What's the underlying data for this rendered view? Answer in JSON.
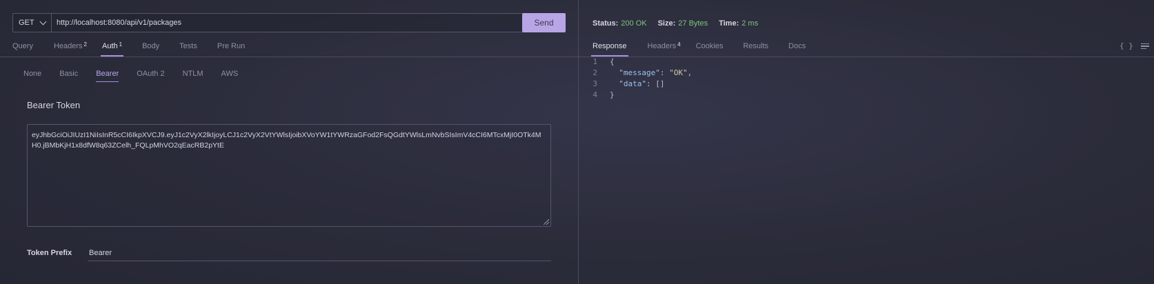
{
  "request": {
    "method": "GET",
    "url": "http://localhost:8080/api/v1/packages",
    "send_label": "Send"
  },
  "request_tabs": [
    {
      "label": "Query",
      "badge": ""
    },
    {
      "label": "Headers",
      "badge": "2"
    },
    {
      "label": "Auth",
      "badge": "1"
    },
    {
      "label": "Body",
      "badge": ""
    },
    {
      "label": "Tests",
      "badge": ""
    },
    {
      "label": "Pre Run",
      "badge": ""
    }
  ],
  "auth_tabs": [
    "None",
    "Basic",
    "Bearer",
    "OAuth 2",
    "NTLM",
    "AWS"
  ],
  "auth": {
    "section_title": "Bearer Token",
    "token": "eyJhbGciOiJIUzI1NiIsInR5cCI6IkpXVCJ9.eyJ1c2VyX2lkIjoyLCJ1c2VyX2VtYWlsIjoibXVoYW1tYWRzaGFod2FsQGdtYWlsLmNvbSIsImV4cCI6MTcxMjI0OTk4MH0.jBMbKjH1x8dfW8q63ZCelh_FQLpMhVO2qEacRB2pYtE",
    "prefix_label": "Token Prefix",
    "prefix_value": "Bearer"
  },
  "response_status": {
    "status_label": "Status:",
    "status_value": "200 OK",
    "size_label": "Size:",
    "size_value": "27 Bytes",
    "time_label": "Time:",
    "time_value": "2 ms"
  },
  "response_tabs": [
    {
      "label": "Response",
      "badge": ""
    },
    {
      "label": "Headers",
      "badge": "4"
    },
    {
      "label": "Cookies",
      "badge": ""
    },
    {
      "label": "Results",
      "badge": ""
    },
    {
      "label": "Docs",
      "badge": ""
    }
  ],
  "response_icons": {
    "format": "{ }",
    "wrap": "wrap-lines-icon"
  },
  "response_body": {
    "line_numbers": [
      "1",
      "2",
      "3",
      "4"
    ],
    "open_brace": "{",
    "message_key": "\"message\"",
    "message_value": "\"OK\"",
    "data_key": "\"data\"",
    "data_value": "[]",
    "close_brace": "}"
  },
  "colors": {
    "accent": "#b7a5e6",
    "success": "#7fc47f",
    "background": "#2a2b38"
  }
}
